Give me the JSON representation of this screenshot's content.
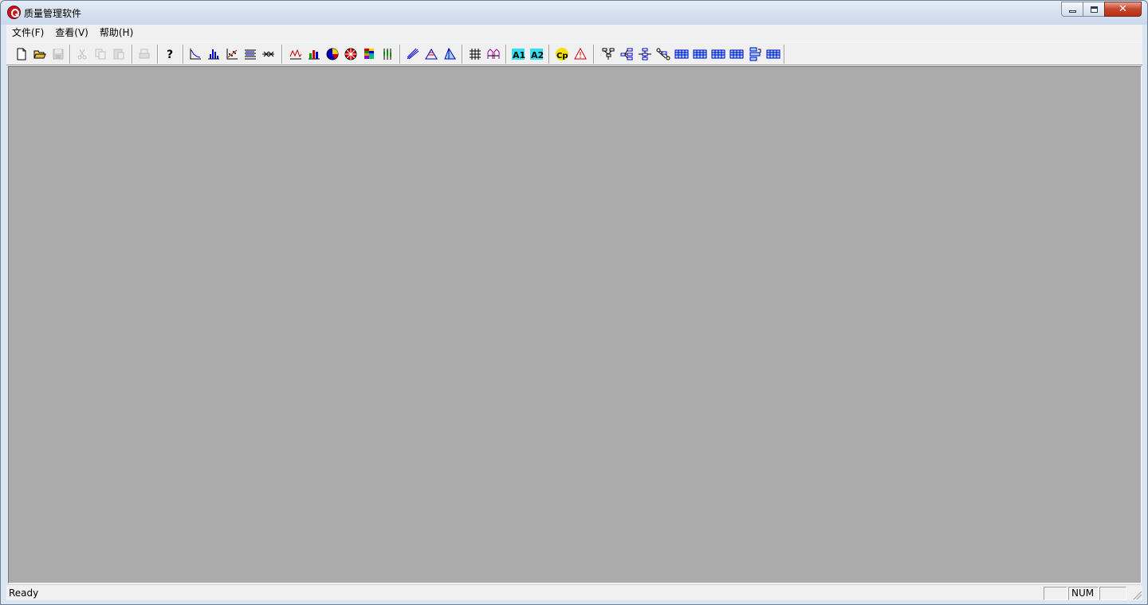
{
  "window": {
    "title": "质量管理软件"
  },
  "menu": {
    "items": [
      {
        "label": "文件(F)"
      },
      {
        "label": "查看(V)"
      },
      {
        "label": "帮助(H)"
      }
    ]
  },
  "toolbar": {
    "buttons": [
      {
        "icon": "new-document-icon",
        "enabled": true
      },
      {
        "icon": "open-folder-icon",
        "enabled": true
      },
      {
        "icon": "save-icon",
        "enabled": false
      },
      {
        "icon": "cut-icon",
        "enabled": false
      },
      {
        "icon": "copy-icon",
        "enabled": false
      },
      {
        "icon": "paste-icon",
        "enabled": false
      },
      {
        "icon": "print-icon",
        "enabled": false
      },
      {
        "icon": "help-icon",
        "enabled": true
      },
      {
        "icon": "pareto-chart-icon",
        "enabled": true
      },
      {
        "icon": "histogram-icon",
        "enabled": true
      },
      {
        "icon": "scatter-plot-icon",
        "enabled": true
      },
      {
        "icon": "stratification-icon",
        "enabled": true
      },
      {
        "icon": "fishbone-diagram-icon",
        "enabled": true
      },
      {
        "icon": "line-chart-icon",
        "enabled": true
      },
      {
        "icon": "bar-chart-icon",
        "enabled": true
      },
      {
        "icon": "pie-chart-icon",
        "enabled": true
      },
      {
        "icon": "radar-chart-icon",
        "enabled": true
      },
      {
        "icon": "color-grid-icon",
        "enabled": true
      },
      {
        "icon": "box-plot-icon",
        "enabled": true
      },
      {
        "icon": "regression-line-icon",
        "enabled": true
      },
      {
        "icon": "surface-chart-icon",
        "enabled": true
      },
      {
        "icon": "triangle-chart-icon",
        "enabled": true
      },
      {
        "icon": "matrix-icon",
        "enabled": true
      },
      {
        "icon": "control-chart-icon",
        "enabled": true
      },
      {
        "icon": "a1-icon",
        "enabled": true
      },
      {
        "icon": "a2-icon",
        "enabled": true
      },
      {
        "icon": "cp-icon",
        "enabled": true
      },
      {
        "icon": "warning-triangle-icon",
        "enabled": true
      },
      {
        "icon": "tree-diagram-icon",
        "enabled": true
      },
      {
        "icon": "relation-diagram-icon",
        "enabled": true
      },
      {
        "icon": "network-diagram-icon",
        "enabled": true
      },
      {
        "icon": "arrow-diagram-icon",
        "enabled": true
      },
      {
        "icon": "table-1-icon",
        "enabled": true
      },
      {
        "icon": "table-2-icon",
        "enabled": true
      },
      {
        "icon": "table-3-icon",
        "enabled": true
      },
      {
        "icon": "table-4-icon",
        "enabled": true
      },
      {
        "icon": "pdpc-diagram-icon",
        "enabled": true
      },
      {
        "icon": "table-5-icon",
        "enabled": true
      }
    ]
  },
  "statusbar": {
    "text": "Ready",
    "panes": [
      "",
      "NUM",
      ""
    ]
  }
}
